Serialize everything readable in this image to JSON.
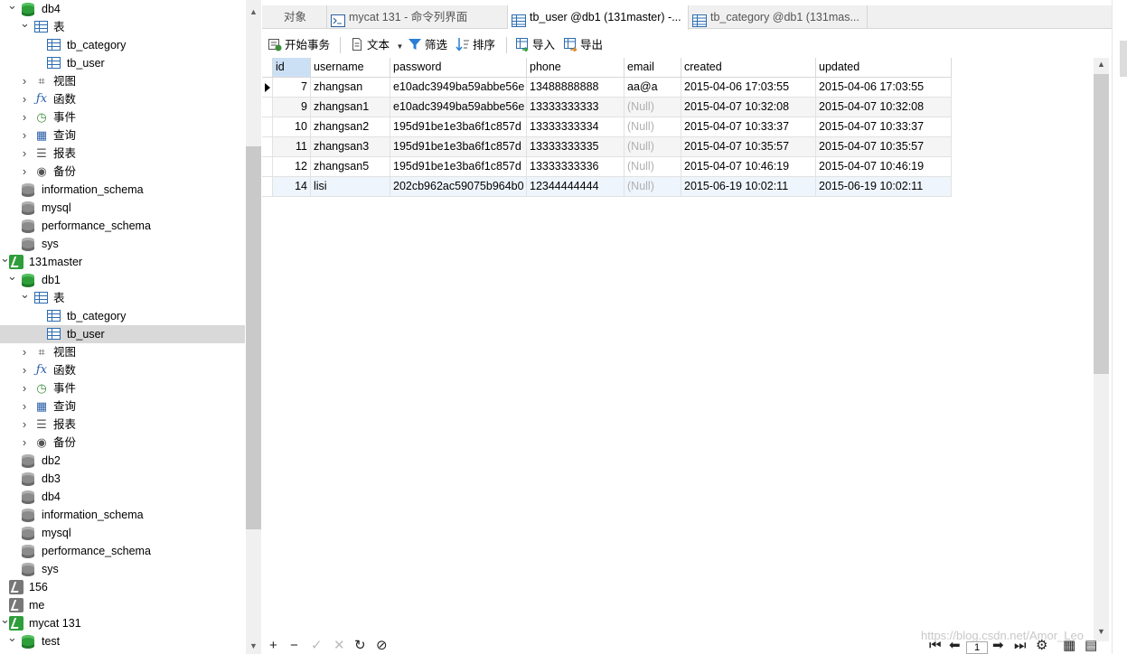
{
  "tree": {
    "items": [
      {
        "label": "db4",
        "type": "db-green",
        "chev": "open",
        "level": 1
      },
      {
        "label": "表",
        "type": "folder-table",
        "chev": "open",
        "level": 2
      },
      {
        "label": "tb_category",
        "type": "table",
        "chev": "",
        "level": 3
      },
      {
        "label": "tb_user",
        "type": "table",
        "chev": "",
        "level": 3
      },
      {
        "label": "视图",
        "type": "view",
        "chev": "closed",
        "level": 2
      },
      {
        "label": "函数",
        "type": "function",
        "chev": "closed",
        "level": 2
      },
      {
        "label": "事件",
        "type": "event",
        "chev": "closed",
        "level": 2
      },
      {
        "label": "查询",
        "type": "query",
        "chev": "closed",
        "level": 2
      },
      {
        "label": "报表",
        "type": "report",
        "chev": "closed",
        "level": 2
      },
      {
        "label": "备份",
        "type": "backup",
        "chev": "closed",
        "level": 2
      },
      {
        "label": "information_schema",
        "type": "db-gray",
        "chev": "",
        "level": 1
      },
      {
        "label": "mysql",
        "type": "db-gray",
        "chev": "",
        "level": 1
      },
      {
        "label": "performance_schema",
        "type": "db-gray",
        "chev": "",
        "level": 1
      },
      {
        "label": "sys",
        "type": "db-gray",
        "chev": "",
        "level": 1
      },
      {
        "label": "131master",
        "type": "conn-green",
        "chev": "open",
        "level": 0
      },
      {
        "label": "db1",
        "type": "db-green",
        "chev": "open",
        "level": 1
      },
      {
        "label": "表",
        "type": "folder-table",
        "chev": "open",
        "level": 2
      },
      {
        "label": "tb_category",
        "type": "table",
        "chev": "",
        "level": 3
      },
      {
        "label": "tb_user",
        "type": "table",
        "chev": "",
        "level": 3,
        "selected": true
      },
      {
        "label": "视图",
        "type": "view",
        "chev": "closed",
        "level": 2
      },
      {
        "label": "函数",
        "type": "function",
        "chev": "closed",
        "level": 2
      },
      {
        "label": "事件",
        "type": "event",
        "chev": "closed",
        "level": 2
      },
      {
        "label": "查询",
        "type": "query",
        "chev": "closed",
        "level": 2
      },
      {
        "label": "报表",
        "type": "report",
        "chev": "closed",
        "level": 2
      },
      {
        "label": "备份",
        "type": "backup",
        "chev": "closed",
        "level": 2
      },
      {
        "label": "db2",
        "type": "db-gray",
        "chev": "",
        "level": 1
      },
      {
        "label": "db3",
        "type": "db-gray",
        "chev": "",
        "level": 1
      },
      {
        "label": "db4",
        "type": "db-gray",
        "chev": "",
        "level": 1
      },
      {
        "label": "information_schema",
        "type": "db-gray",
        "chev": "",
        "level": 1
      },
      {
        "label": "mysql",
        "type": "db-gray",
        "chev": "",
        "level": 1
      },
      {
        "label": "performance_schema",
        "type": "db-gray",
        "chev": "",
        "level": 1
      },
      {
        "label": "sys",
        "type": "db-gray",
        "chev": "",
        "level": 1
      },
      {
        "label": "156",
        "type": "conn-gray",
        "chev": "",
        "level": 0
      },
      {
        "label": "me",
        "type": "conn-gray",
        "chev": "",
        "level": 0
      },
      {
        "label": "mycat 131",
        "type": "conn-green",
        "chev": "open",
        "level": 0
      },
      {
        "label": "test",
        "type": "db-green",
        "chev": "open",
        "level": 1
      }
    ]
  },
  "tabs": [
    {
      "label": "对象",
      "icon": ""
    },
    {
      "label": "mycat 131 - 命令列界面",
      "icon": "terminal-icon"
    },
    {
      "label": "tb_user @db1 (131master) -...",
      "icon": "table-icon",
      "active": true
    },
    {
      "label": "tb_category @db1 (131mas...",
      "icon": "table-icon"
    }
  ],
  "toolbar": {
    "begin_tx": "开始事务",
    "text": "文本",
    "filter": "筛选",
    "sort": "排序",
    "import": "导入",
    "export": "导出"
  },
  "grid": {
    "columns": [
      "id",
      "username",
      "password",
      "phone",
      "email",
      "created",
      "updated"
    ],
    "rows": [
      {
        "id": "7",
        "username": "zhangsan",
        "password": "e10adc3949ba59abbe56e",
        "phone": "13488888888",
        "email": "aa@a",
        "created": "2015-04-06 17:03:55",
        "updated": "2015-04-06 17:03:55"
      },
      {
        "id": "9",
        "username": "zhangsan1",
        "password": "e10adc3949ba59abbe56e",
        "phone": "13333333333",
        "email": "(Null)",
        "created": "2015-04-07 10:32:08",
        "updated": "2015-04-07 10:32:08"
      },
      {
        "id": "10",
        "username": "zhangsan2",
        "password": "195d91be1e3ba6f1c857d",
        "phone": "13333333334",
        "email": "(Null)",
        "created": "2015-04-07 10:33:37",
        "updated": "2015-04-07 10:33:37"
      },
      {
        "id": "11",
        "username": "zhangsan3",
        "password": "195d91be1e3ba6f1c857d",
        "phone": "13333333335",
        "email": "(Null)",
        "created": "2015-04-07 10:35:57",
        "updated": "2015-04-07 10:35:57"
      },
      {
        "id": "12",
        "username": "zhangsan5",
        "password": "195d91be1e3ba6f1c857d",
        "phone": "13333333336",
        "email": "(Null)",
        "created": "2015-04-07 10:46:19",
        "updated": "2015-04-07 10:46:19"
      },
      {
        "id": "14",
        "username": "lisi",
        "password": "202cb962ac59075b964b0",
        "phone": "12344444444",
        "email": "(Null)",
        "created": "2015-06-19 10:02:11",
        "updated": "2015-06-19 10:02:11"
      }
    ]
  },
  "bottombar": {
    "page": "1"
  },
  "watermark": "https://blog.csdn.net/Amor_Leo"
}
